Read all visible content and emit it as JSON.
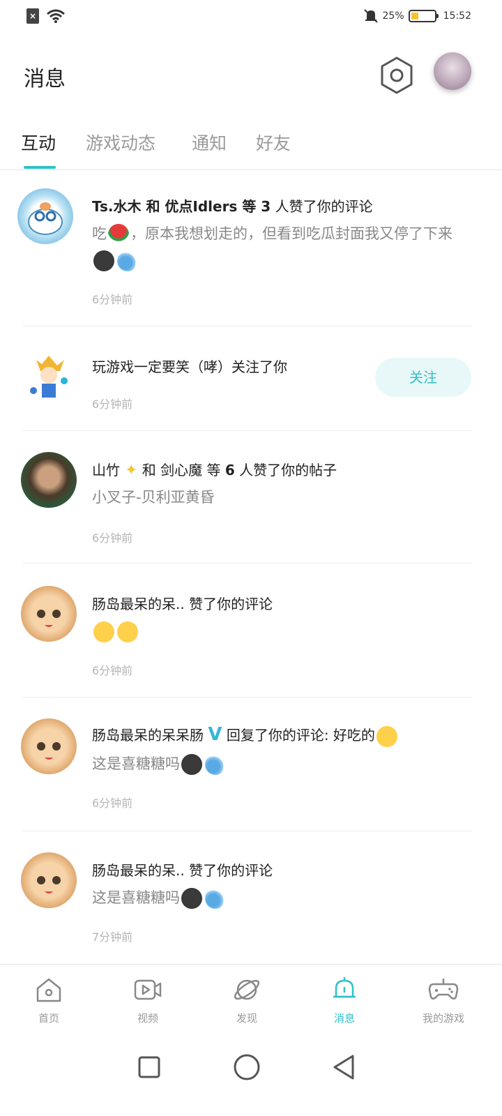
{
  "status_bar": {
    "battery": "25%",
    "time": "15:52"
  },
  "header": {
    "title": "消息"
  },
  "tabs": [
    {
      "label": "互动"
    },
    {
      "label": "游戏动态"
    },
    {
      "label": "通知"
    },
    {
      "label": "好友"
    }
  ],
  "messages": [
    {
      "pre": "Ts.水木 和 优点Idlers 等 ",
      "count": "3",
      "post": " 人赞了你的评论",
      "content_a": "吃",
      "content_b": "，原本我想划走的，但看到吃瓜封面我又停了下来",
      "time": "6分钟前"
    },
    {
      "text": "玩游戏一定要笑（哮）关注了你",
      "follow_label": "关注",
      "time": "6分钟前"
    },
    {
      "name": "山竹",
      "pre": " 和 剑心魔 等 ",
      "count": "6",
      "post": " 人赞了你的帖子",
      "content": "小叉子-贝利亚黄昏",
      "time": "6分钟前"
    },
    {
      "text": "肠岛最呆的呆.. 赞了你的评论",
      "time": "6分钟前"
    },
    {
      "name": "肠岛最呆的呆呆肠",
      "verify": "V",
      "post": " 回复了你的评论: 好吃的",
      "content": "这是喜糖糖吗",
      "time": "6分钟前"
    },
    {
      "text": "肠岛最呆的呆.. 赞了你的评论",
      "content": "这是喜糖糖吗",
      "time": "7分钟前"
    }
  ],
  "bottom_nav": [
    {
      "label": "首页",
      "icon": "home-icon"
    },
    {
      "label": "视频",
      "icon": "video-icon"
    },
    {
      "label": "发现",
      "icon": "planet-icon"
    },
    {
      "label": "消息",
      "icon": "bell-icon"
    },
    {
      "label": "我的游戏",
      "icon": "gamepad-icon"
    }
  ],
  "colors": {
    "accent": "#2ec1c4",
    "follow_bg": "#e8f8f8",
    "battery": "#f5c431"
  }
}
